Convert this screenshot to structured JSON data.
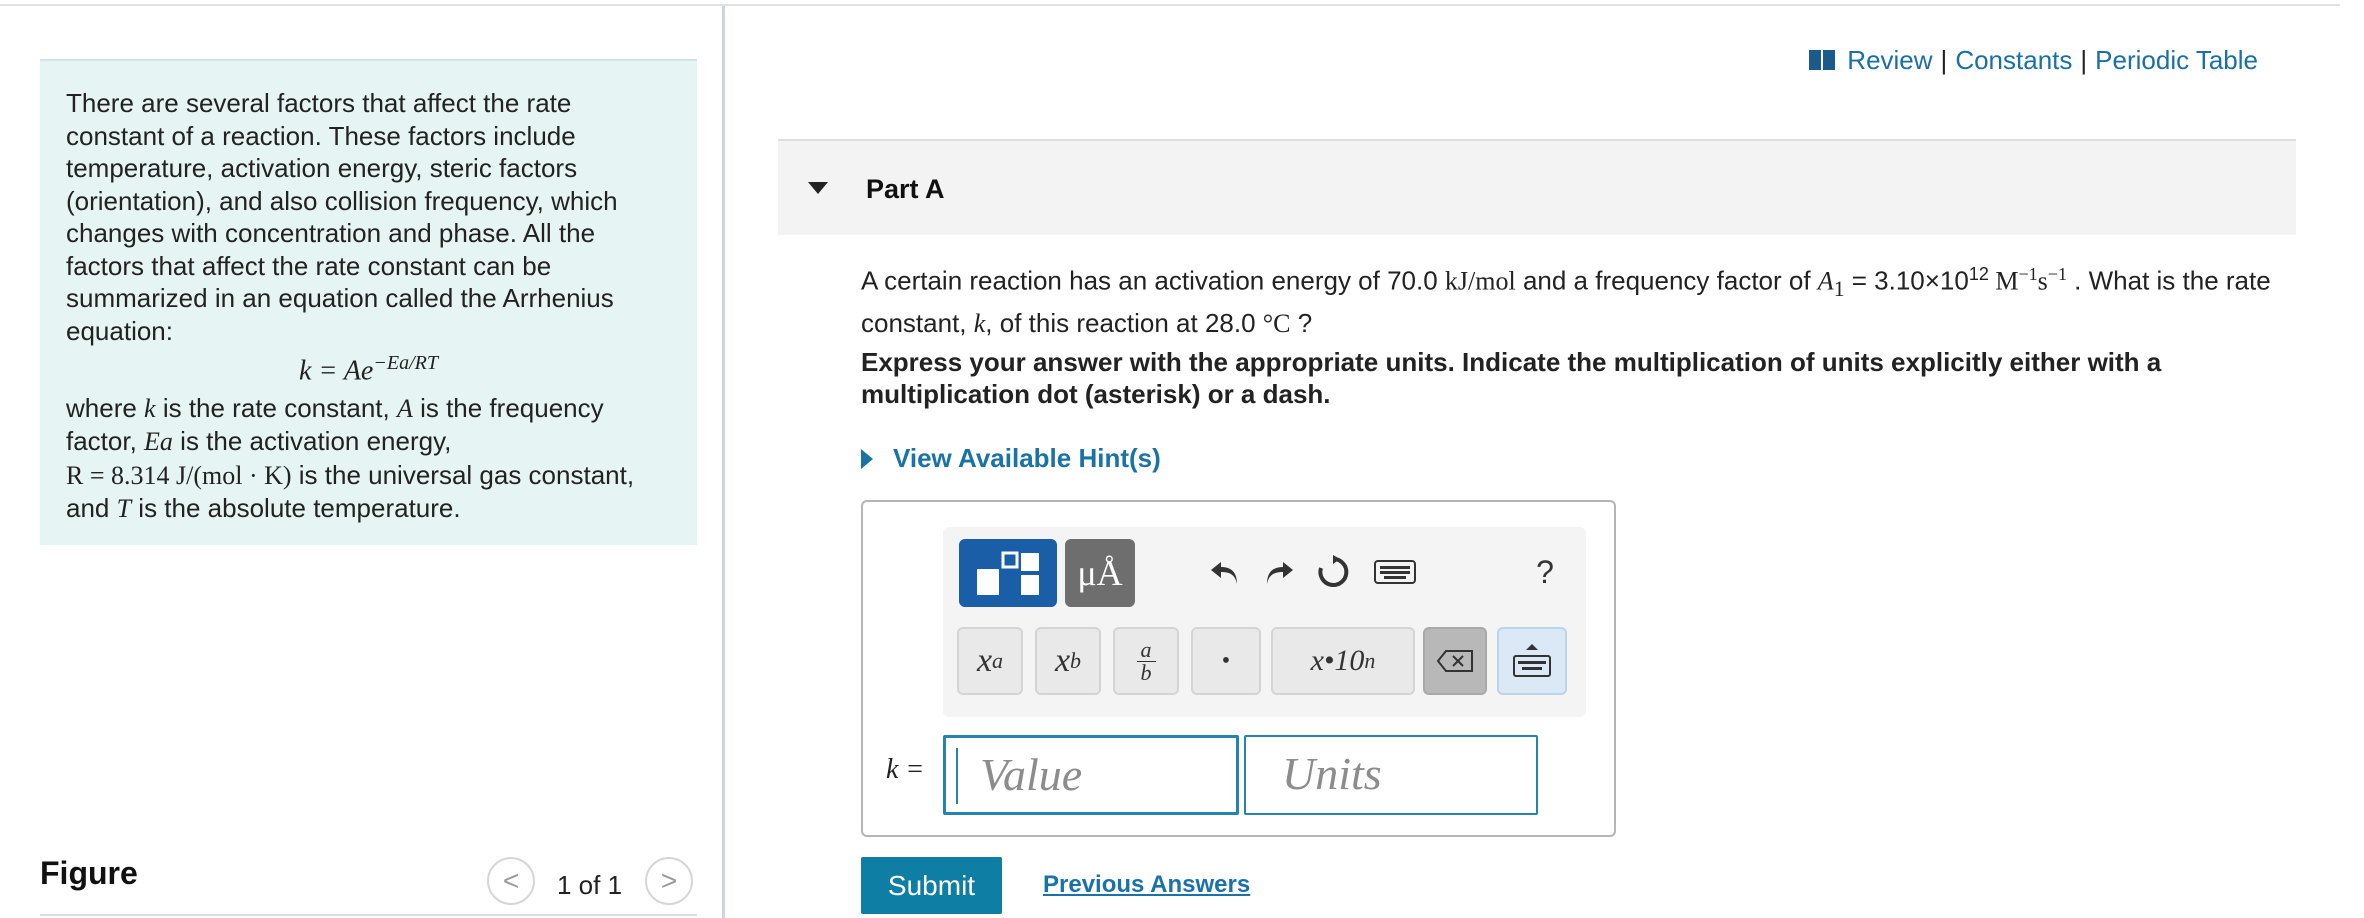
{
  "intro": {
    "para1": "There are several factors that affect the rate constant of a reaction. These factors include temperature, activation energy, steric factors (orientation), and also collision frequency, which changes with concentration and phase. All the factors that affect the rate constant can be summarized in an equation called the Arrhenius equation:",
    "equation_lhs": "k = Ae",
    "equation_exp": "−Ea/RT",
    "p2_a": "where ",
    "p2_k": "k",
    "p2_b": " is the rate constant, ",
    "p2_A": "A",
    "p2_c": " is the frequency factor, ",
    "p2_Ea": "Ea",
    "p2_d": " is the activation energy,",
    "p2_R": "R = 8.314 J/(mol · K)",
    "p2_e": " is the universal gas constant, and ",
    "p2_T": "T",
    "p2_f": " is the absolute temperature."
  },
  "figure": {
    "title": "Figure",
    "pager": "1 of 1",
    "prev_glyph": "<",
    "next_glyph": ">"
  },
  "toplinks": {
    "review": "Review",
    "sep": "|",
    "constants": "Constants",
    "periodic_table": "Periodic Table"
  },
  "part": {
    "title": "Part A"
  },
  "question": {
    "t1": "A certain reaction has an activation energy of 70.0 ",
    "energy_unit": "kJ/mol",
    "t2": " and a frequency factor of ",
    "A1_sym": "A",
    "A1_sub": "1",
    "t3": " = 3.10×10",
    "exp": "12",
    "unit_M": " M",
    "unit_M_exp": "−1",
    "unit_s": "s",
    "unit_s_exp": "−1",
    "t4": " . What is the rate constant, ",
    "k_sym": "k",
    "t5": ", of this reaction at 28.0 ",
    "temp_unit": "°C",
    "t6": " ?"
  },
  "instructions": "Express your answer with the appropriate units.  Indicate the multiplication of units explicitly either with a multiplication dot (asterisk) or a dash.",
  "hints": {
    "label": "View Available Hint(s)"
  },
  "toolbar": {
    "units_label": "μÅ",
    "help_label": "?",
    "sym_superscript_base": "x",
    "sym_superscript_exp": "a",
    "sym_subscript_base": "x",
    "sym_subscript_sub": "b",
    "sym_frac_num": "a",
    "sym_frac_den": "b",
    "sym_dot": "•",
    "sym_sci": "x•10",
    "sym_sci_exp": "n"
  },
  "answer": {
    "label": "k =",
    "value_placeholder": "Value",
    "units_placeholder": "Units"
  },
  "actions": {
    "submit": "Submit",
    "previous_answers": "Previous Answers"
  }
}
